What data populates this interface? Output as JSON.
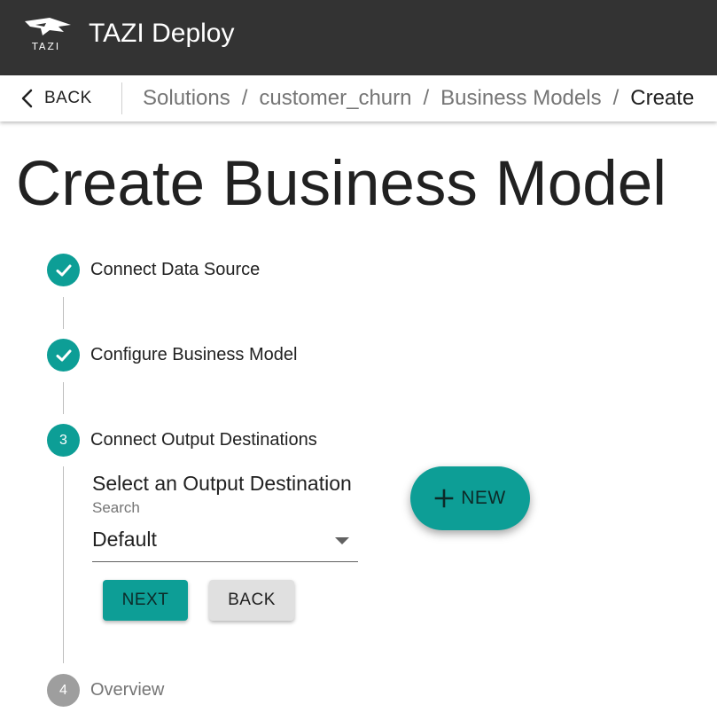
{
  "app": {
    "logo_text": "TAZI",
    "title": "TAZI Deploy"
  },
  "nav": {
    "back_label": "BACK",
    "breadcrumbs": [
      "Solutions",
      "customer_churn",
      "Business Models",
      "Create"
    ],
    "separator": "/"
  },
  "page": {
    "title": "Create Business Model"
  },
  "stepper": {
    "steps": [
      {
        "label": "Connect Data Source",
        "status": "completed",
        "icon": "check-icon"
      },
      {
        "label": "Configure Business Model",
        "status": "completed",
        "icon": "check-icon"
      },
      {
        "label": "Connect Output Destinations",
        "status": "active",
        "number": "3"
      },
      {
        "label": "Overview",
        "status": "pending",
        "number": "4"
      }
    ]
  },
  "output_step": {
    "section_title": "Select an Output Destination",
    "select_label": "Search",
    "selected_value": "Default",
    "next_label": "NEXT",
    "back_label": "BACK",
    "new_label": "NEW"
  },
  "colors": {
    "appbar": "#333333",
    "accent": "#0d9e96",
    "inactive_step": "#9e9e9e"
  }
}
